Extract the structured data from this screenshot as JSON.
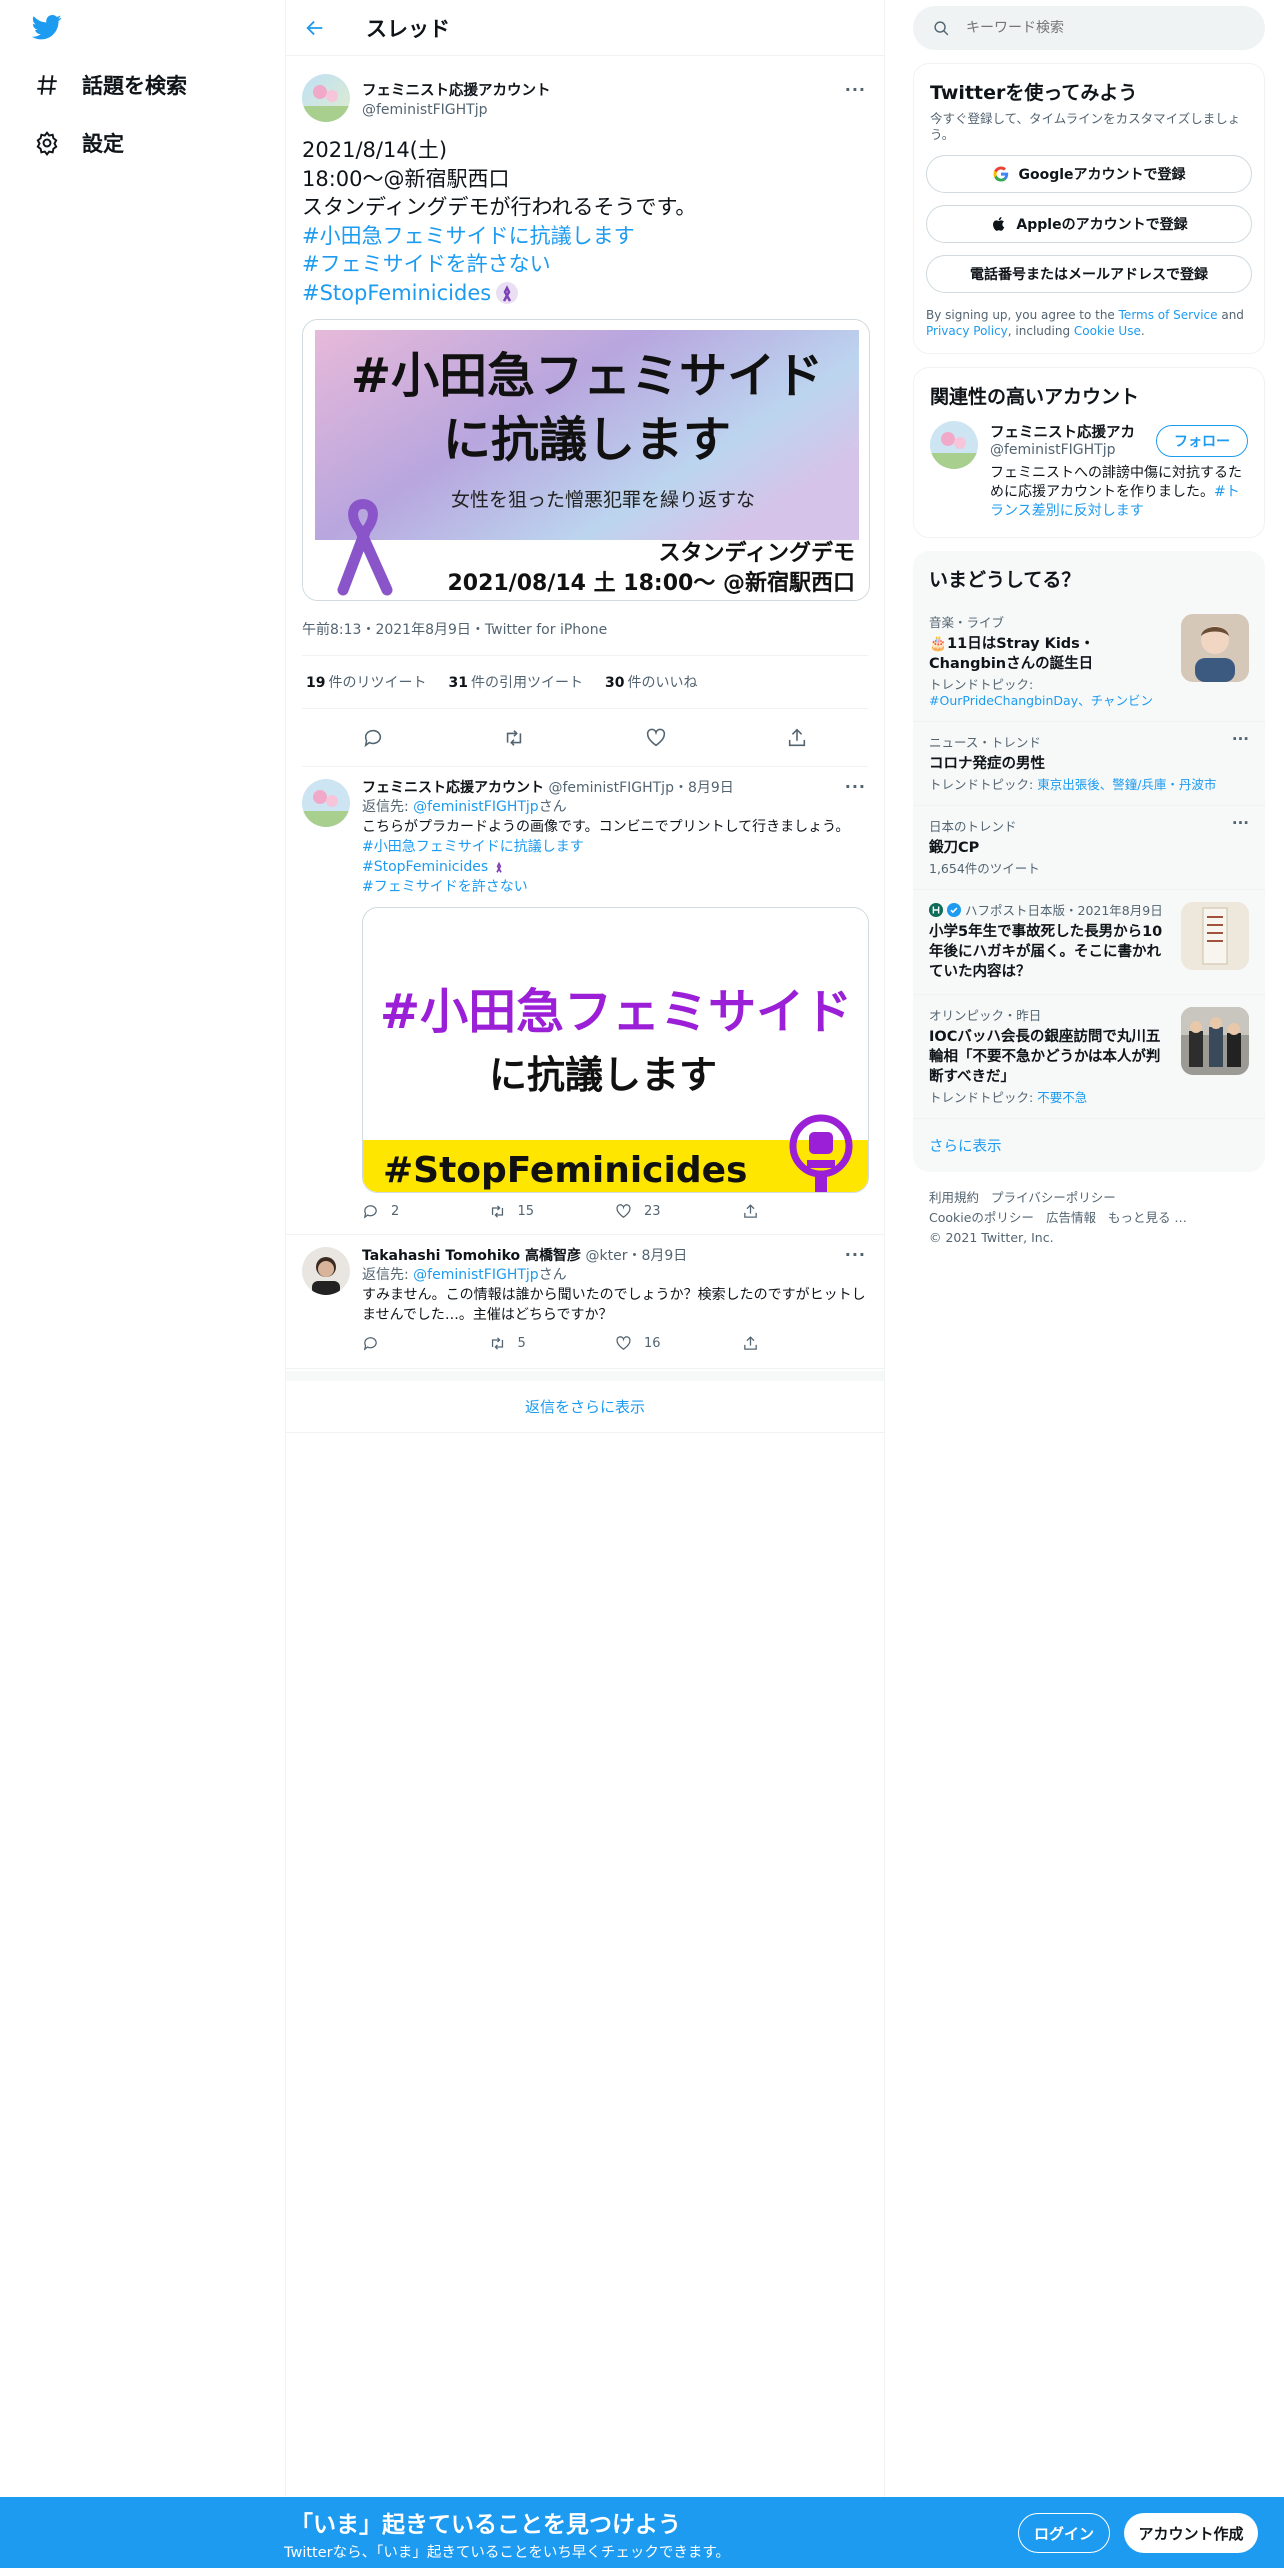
{
  "nav": {
    "explore_label": "話題を検索",
    "settings_label": "設定"
  },
  "header": {
    "title": "スレッド"
  },
  "main_tweet": {
    "name": "フェミニスト応援アカウント",
    "handle": "@feministFIGHTjp",
    "text_lines": [
      "2021/8/14(土)",
      "18:00〜@新宿駅西口",
      "スタンディングデモが行われるそうです。"
    ],
    "hashtags": [
      "#小田急フェミサイドに抗議します",
      "#フェミサイドを許さない",
      "#StopFeminicides"
    ],
    "image": {
      "headline_1": "#小田急フェミサイド",
      "headline_2": "に抗議します",
      "subline": "女性を狙った憎悪犯罪を繰り返すな",
      "event": "スタンディングデモ",
      "event_detail": "2021/08/14 土 18:00〜 @新宿駅西口"
    },
    "timestamp": "午前8:13・2021年8月9日・Twitter for iPhone",
    "stats": {
      "retweets_count": "19",
      "retweets_label": "件のリツイート",
      "quotes_count": "31",
      "quotes_label": "件の引用ツイート",
      "likes_count": "30",
      "likes_label": "件のいいね"
    }
  },
  "replies": [
    {
      "name": "フェミニスト応援アカウント",
      "handle": "@feministFIGHTjp",
      "date": "・8月9日",
      "reply_prefix": "返信先: ",
      "reply_to": "@feministFIGHTjp",
      "reply_suffix": "さん",
      "text": "こちらがプラカードようの画像です。コンビニでプリントして行きましょう。",
      "hashtags": [
        "#小田急フェミサイドに抗議します",
        "#StopFeminicides",
        "#フェミサイドを許さない"
      ],
      "image": {
        "headline_1": "#小田急フェミサイド",
        "headline_2": "に抗議します",
        "banner": "#StopFeminicides"
      },
      "replies": "2",
      "retweets": "15",
      "likes": "23"
    },
    {
      "name": "Takahashi Tomohiko 高橋智彦",
      "handle": "@kter",
      "date": "・8月9日",
      "reply_prefix": "返信先: ",
      "reply_to": "@feministFIGHTjp",
      "reply_suffix": "さん",
      "text": "すみません。この情報は誰から聞いたのでしょうか？検索したのですがヒットしませんでした…。主催はどちらですか？",
      "replies": "",
      "retweets": "5",
      "likes": "16"
    }
  ],
  "show_more_replies": "返信をさらに表示",
  "search": {
    "placeholder": "キーワード検索"
  },
  "signup_panel": {
    "title": "Twitterを使ってみよう",
    "subtitle": "今すぐ登録して、タイムラインをカスタマイズしましょう。",
    "google_label": "Googleアカウントで登録",
    "apple_label": "Appleのアカウントで登録",
    "phone_label": "電話番号またはメールアドレスで登録",
    "legal_1": "By signing up, you agree to the ",
    "legal_tos": "Terms of Service",
    "legal_2": " and ",
    "legal_privacy": "Privacy Policy",
    "legal_3": ", including ",
    "legal_cookie": "Cookie Use",
    "legal_4": "."
  },
  "related_panel": {
    "title": "関連性の高いアカウント",
    "name": "フェミニスト応援アカ",
    "handle": "@feministFIGHTjp",
    "bio": "フェミニストへの誹謗中傷に対抗するために応援アカウントを作りました。",
    "bio_tag": "#トランス差別に反対します",
    "follow_label": "フォロー"
  },
  "trends_panel": {
    "title": "いまどうしてる？",
    "items": [
      {
        "category": "音楽・ライブ",
        "title": "🎂11日はStray Kids・Changbinさんの誕生日",
        "meta_label": "トレンドトピック: ",
        "meta_link": "#OurPrideChangbinDay、チャンビン"
      },
      {
        "category": "ニュース・トレンド",
        "title": "コロナ発症の男性",
        "meta_label": "トレンドトピック: ",
        "meta_link": "東京出張後、警鐘/兵庫・丹波市"
      },
      {
        "category": "日本のトレンド",
        "title": "鍛刀CP",
        "meta_label": "1,654件のツイート",
        "meta_link": ""
      },
      {
        "category": "ハフポスト日本版・2021年8月9日",
        "title": "小学5年生で事故死した長男から10年後にハガキが届く。そこに書かれていた内容は？",
        "meta_label": "",
        "meta_link": ""
      },
      {
        "category": "オリンピック・昨日",
        "title": "IOCバッハ会長の銀座訪問で丸川五輪相「不要不急かどうかは本人が判断すべきだ」",
        "meta_label": "トレンドトピック: ",
        "meta_link": "不要不急"
      }
    ],
    "show_more": "さらに表示"
  },
  "footer": {
    "links": [
      "利用規約",
      "プライバシーポリシー",
      "Cookieのポリシー",
      "広告情報",
      "もっと見る …"
    ],
    "copyright": "© 2021 Twitter, Inc."
  },
  "bottom_bar": {
    "title": "「いま」起きていることを見つけよう",
    "subtitle": "Twitterなら、「いま」起きていることをいち早くチェックできます。",
    "login_label": "ログイン",
    "signup_label": "アカウント作成"
  },
  "colors": {
    "accent": "#1d9bf0",
    "purple_text": "#9b1fd6",
    "banner_yellow": "#ffe600"
  }
}
